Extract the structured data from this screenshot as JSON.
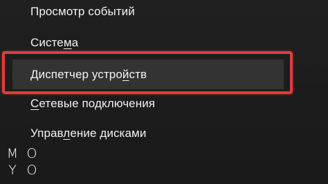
{
  "menu": {
    "items": [
      {
        "label_pre": "Просмотр событий",
        "label_u": "",
        "label_post": ""
      },
      {
        "label_pre": "Систе",
        "label_u": "м",
        "label_post": "а"
      },
      {
        "label_pre": "Диспетчер устро",
        "label_u": "й",
        "label_post": "ств"
      },
      {
        "label_pre": "",
        "label_u": "С",
        "label_post": "етевые подключения"
      },
      {
        "label_pre": "Управ",
        "label_u": "л",
        "label_post": "ение дисками"
      }
    ],
    "selected_index": 2
  },
  "colors": {
    "background": "#1e1e1e",
    "highlight_row": "#333333",
    "annotation_border": "#e23c3c",
    "text": "#f2f2f2"
  },
  "logo": {
    "letters": [
      "M",
      "O",
      "Y",
      "O"
    ]
  }
}
